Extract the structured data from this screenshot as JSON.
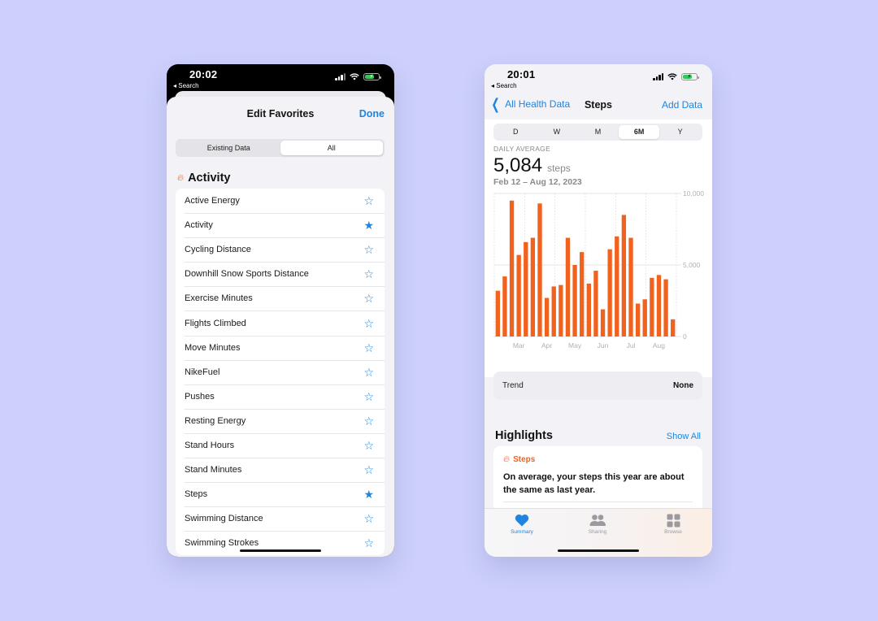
{
  "left_phone": {
    "status": {
      "time": "20:02",
      "back": "◂ Search"
    },
    "sheet": {
      "title": "Edit Favorites",
      "done_label": "Done"
    },
    "segments": [
      {
        "label": "Existing Data",
        "active": false
      },
      {
        "label": "All",
        "active": true
      }
    ],
    "section": {
      "icon": "flame-icon",
      "title": "Activity"
    },
    "items": [
      {
        "label": "Active Energy",
        "favorite": false
      },
      {
        "label": "Activity",
        "favorite": true
      },
      {
        "label": "Cycling Distance",
        "favorite": false
      },
      {
        "label": "Downhill Snow Sports Distance",
        "favorite": false
      },
      {
        "label": "Exercise Minutes",
        "favorite": false
      },
      {
        "label": "Flights Climbed",
        "favorite": false
      },
      {
        "label": "Move Minutes",
        "favorite": false
      },
      {
        "label": "NikeFuel",
        "favorite": false
      },
      {
        "label": "Pushes",
        "favorite": false
      },
      {
        "label": "Resting Energy",
        "favorite": false
      },
      {
        "label": "Stand Hours",
        "favorite": false
      },
      {
        "label": "Stand Minutes",
        "favorite": false
      },
      {
        "label": "Steps",
        "favorite": true
      },
      {
        "label": "Swimming Distance",
        "favorite": false
      },
      {
        "label": "Swimming Strokes",
        "favorite": false
      }
    ]
  },
  "right_phone": {
    "status": {
      "time": "20:01",
      "back": "◂ Search"
    },
    "nav": {
      "back_label": "All Health Data",
      "title": "Steps",
      "action_label": "Add Data"
    },
    "ranges": [
      {
        "label": "D",
        "active": false
      },
      {
        "label": "W",
        "active": false
      },
      {
        "label": "M",
        "active": false
      },
      {
        "label": "6M",
        "active": true
      },
      {
        "label": "Y",
        "active": false
      }
    ],
    "summary": {
      "label": "DAILY AVERAGE",
      "value": "5,084",
      "unit": "steps",
      "date_range": "Feb 12 – Aug 12, 2023"
    },
    "trend": {
      "label": "Trend",
      "value": "None"
    },
    "highlights": {
      "title": "Highlights",
      "show_all_label": "Show All",
      "card": {
        "icon": "flame-icon",
        "category": "Steps",
        "text": "On average, your steps this year are about the same as last year."
      }
    },
    "tabs": [
      {
        "label": "Summary",
        "icon": "heart-icon",
        "active": true
      },
      {
        "label": "Sharing",
        "icon": "people-icon",
        "active": false
      },
      {
        "label": "Browse",
        "icon": "grid-icon",
        "active": false
      }
    ]
  },
  "colors": {
    "accent": "#1f85e0",
    "bar": "#f2621f",
    "background": "#cdd0fb"
  },
  "chart_data": {
    "type": "bar",
    "x": [
      1,
      2,
      3,
      4,
      5,
      6,
      7,
      8,
      9,
      10,
      11,
      12,
      13,
      14,
      15,
      16,
      17,
      18,
      19,
      20,
      21,
      22,
      23,
      24,
      25
    ],
    "values": [
      3200,
      4200,
      9500,
      5700,
      6600,
      6900,
      9300,
      2700,
      3500,
      3600,
      6900,
      5000,
      5900,
      3700,
      4600,
      1900,
      6100,
      7000,
      8500,
      6900,
      2300,
      2600,
      4100,
      4300,
      4000,
      1200
    ],
    "ylim": [
      0,
      10000
    ],
    "yticks": [
      {
        "value": 0,
        "label": "0"
      },
      {
        "value": 5000,
        "label": "5,000"
      },
      {
        "value": 10000,
        "label": "10,000"
      }
    ],
    "month_labels": [
      "Mar",
      "Apr",
      "May",
      "Jun",
      "Jul",
      "Aug"
    ],
    "month_label_bar_index": [
      3,
      7,
      11,
      15,
      19,
      23
    ],
    "ylabel": "steps",
    "grid": true
  }
}
